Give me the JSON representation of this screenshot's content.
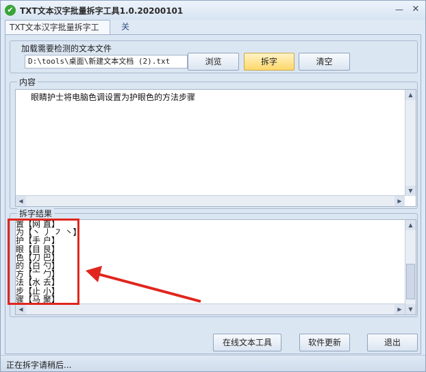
{
  "window": {
    "title": "TXT文本汉字批量拆字工具1.0.20200101",
    "minimize_glyph": "—",
    "close_glyph": "✕"
  },
  "tabs": [
    {
      "label": "TXT文本汉字批量拆字工具",
      "active": true
    },
    {
      "label": "关于",
      "active": false
    }
  ],
  "load_section": {
    "label": "加载需要检测的文本文件",
    "path_value": "D:\\tools\\桌面\\新建文本文档 (2).txt",
    "browse_label": "浏览",
    "split_label": "拆字",
    "clear_label": "清空"
  },
  "content_section": {
    "label": "内容",
    "text": "眼睛护士将电脑色调设置为护眼色的方法步骤"
  },
  "result_section": {
    "label": "拆字结果",
    "lines": [
      "置【网 直】",
      "为【丶 丿 ㇇ 丶】",
      "护【手 户】",
      "眼【目 艮】",
      "色【刀 巴】",
      "的【白 勺】",
      "方【亠 勹】",
      "法【水 去】",
      "步【止 小】",
      "骤【马 聚】"
    ]
  },
  "bottom_buttons": {
    "online_tool_label": "在线文本工具",
    "update_label": "软件更新",
    "exit_label": "退出"
  },
  "status": {
    "text": "正在拆字请稍后..."
  },
  "colors": {
    "accent_highlight": "#ffd86b",
    "annotation": "#e0261d",
    "window_bg": "#dfe9f5"
  }
}
